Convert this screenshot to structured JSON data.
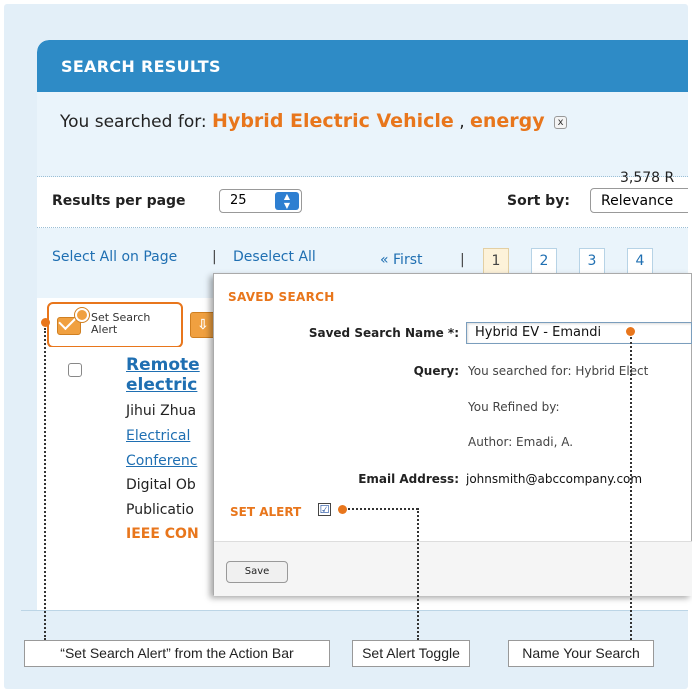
{
  "header": {
    "title": "SEARCH RESULTS"
  },
  "search": {
    "prefix": "You searched for:",
    "term1": "Hybrid Electric Vehicle",
    "separator": ",",
    "term2": "energy",
    "remove_icon": "x",
    "count": "3,578 R"
  },
  "controls": {
    "results_per_page_label": "Results per page",
    "results_per_page_value": "25",
    "sort_label": "Sort by:",
    "sort_value": "Relevance"
  },
  "selection": {
    "select_all": "Select All on Page",
    "separator": "|",
    "deselect_all": "Deselect All",
    "first": "« First",
    "pipe": "|",
    "pages": [
      "1",
      "2",
      "3",
      "4"
    ]
  },
  "action_bar": {
    "set_alert_line1": "Set Search",
    "set_alert_line2": "Alert",
    "download_icon": "down-arrow-icon"
  },
  "result": {
    "title_line1": "Remote",
    "title_line2": "electric",
    "authors": "Jihui Zhua",
    "link1": "Electrical",
    "link2": "Conferenc",
    "line_doi": "Digital Ob",
    "line_pub": "Publicatio",
    "publisher": "IEEE CON"
  },
  "modal": {
    "title": "SAVED SEARCH",
    "name_label": "Saved Search Name *:",
    "name_value": "Hybrid EV - Emandi",
    "query_label": "Query:",
    "query_value": "You searched for: Hybrid Elect",
    "refined": "You Refined by:",
    "author": "Author: Emadi, A.",
    "email_label": "Email Address:",
    "email_value": "johnsmith@abccompany.com",
    "set_alert_label": "SET ALERT",
    "set_alert_checked": "☑",
    "save_button": "Save"
  },
  "callouts": {
    "set_search_alert": "“Set Search Alert” from the Action Bar",
    "set_alert_toggle": "Set Alert Toggle",
    "name_your_search": "Name Your Search"
  },
  "colors": {
    "accent": "#e8761c",
    "header": "#2e8bc6",
    "link": "#1f6fb2",
    "frame": "#e3eff8"
  }
}
